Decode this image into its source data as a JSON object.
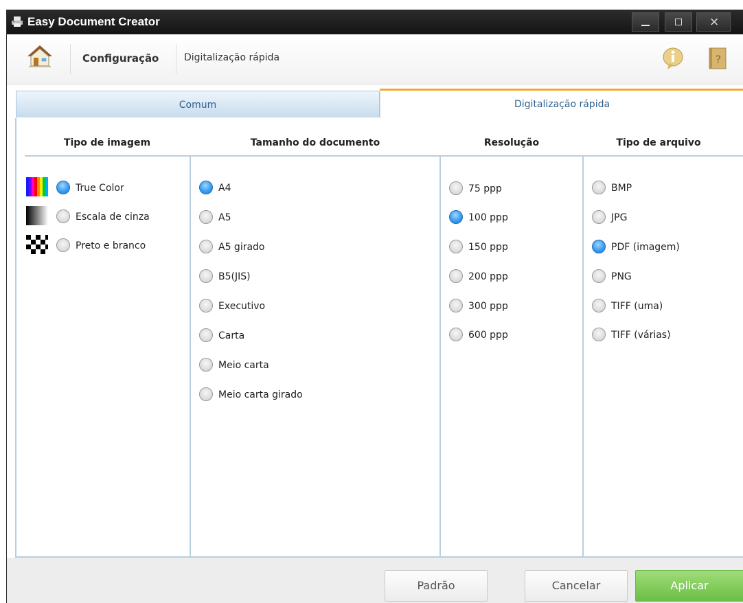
{
  "window": {
    "title": "Easy Document Creator"
  },
  "toolbar": {
    "breadcrumb_section": "Configuração",
    "breadcrumb_page": "Digitalização rápida"
  },
  "tabs": [
    {
      "label": "Comum",
      "active": false
    },
    {
      "label": "Digitalização rápida",
      "active": true
    }
  ],
  "image_type": {
    "header": "Tipo de imagem",
    "options": [
      {
        "label": "True Color",
        "selected": true,
        "icon": "color-bars-icon"
      },
      {
        "label": "Escala de cinza",
        "selected": false,
        "icon": "grayscale-gradient-icon"
      },
      {
        "label": "Preto e branco",
        "selected": false,
        "icon": "checkerboard-icon"
      }
    ]
  },
  "document_size": {
    "header": "Tamanho do documento",
    "options": [
      {
        "label": "A4",
        "selected": true
      },
      {
        "label": "A5",
        "selected": false
      },
      {
        "label": "A5 girado",
        "selected": false
      },
      {
        "label": "B5(JIS)",
        "selected": false
      },
      {
        "label": "Executivo",
        "selected": false
      },
      {
        "label": "Carta",
        "selected": false
      },
      {
        "label": "Meio carta",
        "selected": false
      },
      {
        "label": "Meio carta girado",
        "selected": false
      }
    ]
  },
  "resolution": {
    "header": "Resolução",
    "options": [
      {
        "label": "75 ppp",
        "selected": false
      },
      {
        "label": "100 ppp",
        "selected": true
      },
      {
        "label": "150 ppp",
        "selected": false
      },
      {
        "label": "200 ppp",
        "selected": false
      },
      {
        "label": "300 ppp",
        "selected": false
      },
      {
        "label": "600 ppp",
        "selected": false
      }
    ]
  },
  "file_type": {
    "header": "Tipo de arquivo",
    "options": [
      {
        "label": "BMP",
        "selected": false
      },
      {
        "label": "JPG",
        "selected": false
      },
      {
        "label": "PDF (imagem)",
        "selected": true
      },
      {
        "label": "PNG",
        "selected": false
      },
      {
        "label": "TIFF (uma)",
        "selected": false
      },
      {
        "label": "TIFF (várias)",
        "selected": false
      }
    ]
  },
  "footer": {
    "default_label": "Padrão",
    "cancel_label": "Cancelar",
    "apply_label": "Aplicar"
  },
  "colors": {
    "accent_tab": "#f0a830",
    "radio_selected": "#3a9cf0",
    "apply_button": "#6bbf46",
    "titlebar": "#1e1e1e"
  }
}
